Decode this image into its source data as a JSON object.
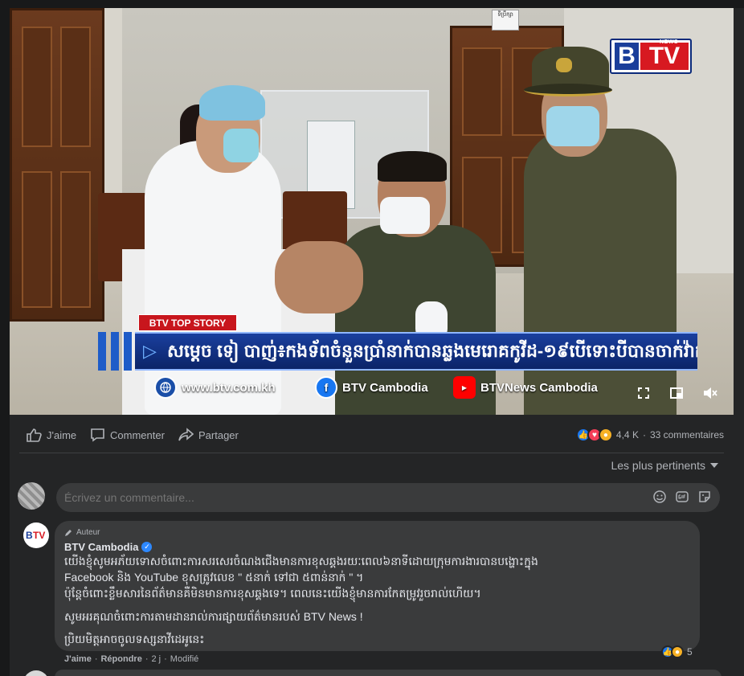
{
  "video": {
    "logo": {
      "letter_b": "B",
      "letters_tv": "TV",
      "news": "NEWS"
    },
    "door_sign": "ទីប្រឹក្សា",
    "top_story_label": "BTV TOP STORY",
    "headline": "សម្តេច ទៀ បាញ់៖កងទ័ពចំនួនប្រាំនាក់បានឆ្លងមេរោគកូវីដ-១៩បើទោះបីបានចាក់វ៉ាក់សាំងរួចក្តី",
    "social": {
      "website": "www.btv.com.kh",
      "facebook": "BTV Cambodia",
      "youtube": "BTVNews Cambodia"
    }
  },
  "actions": {
    "like": "J'aime",
    "comment": "Commenter",
    "share": "Partager"
  },
  "reactions": {
    "count": "4,4 K",
    "comments": "33 commentaires"
  },
  "sort": {
    "label": "Les plus pertinents"
  },
  "comment_box": {
    "placeholder": "Écrivez un commentaire..."
  },
  "comment": {
    "author_badge": "Auteur",
    "author": "BTV Cambodia",
    "lines": [
      "យើងខ្ញុំសូមអភ័យទោសចំពោះការសរសេរចំណងជើងមានការខុសឆ្គងរយៈពេល៦នាទីដោយក្រុមការងារបានបង្ហោះក្នុង",
      "Facebook និង YouTube ខុសត្រូវលេខ \" ៥នាក់ ទៅជា ៥ពាន់នាក់ \" ។",
      "ប៉ុន្តែចំពោះខ្លឹមសារនៃព័ត៌មានគឺមិនមានការខុសឆ្គងទេ។ ពេលនេះយើងខ្ញុំមានការកែតម្រូវរួចរាល់ហើយ។",
      "សូមអរគុណចំពោះការតាមដានរាល់ការផ្សាយព័ត៌មានរបស់ BTV News !",
      "ប្រិយមិត្តអាចចូលទស្សនាវីដេអូនេះ"
    ],
    "reaction_count": "5",
    "footer": {
      "like": "J'aime",
      "sep1": "·",
      "reply": "Répondre",
      "sep2": "·",
      "time": "2 j",
      "sep3": "·",
      "edited": "Modifié"
    }
  },
  "colors": {
    "background": "#242526",
    "bubble": "#3a3b3c",
    "facebook_blue": "#2d88ff",
    "btv_red": "#d71921",
    "btv_blue": "#1a3e9a"
  }
}
